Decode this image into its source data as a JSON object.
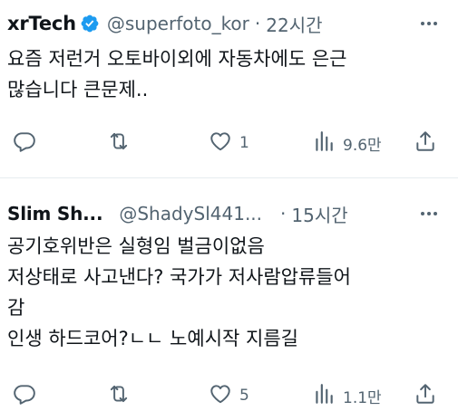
{
  "tweets": [
    {
      "name": "xrTech",
      "verified": true,
      "handle": "@superfoto_kor",
      "separator": "·",
      "time": "22시간",
      "lines": [
        "요즘 저런거 오토바이외에 자동차에도 은근",
        "많습니다 큰문제.."
      ],
      "reply_count": "",
      "retweet_count": "",
      "like_count": "1",
      "view_count": "9.6만"
    },
    {
      "name": "Slim Sh...",
      "verified": false,
      "handle": "@ShadySl441...",
      "separator": "·",
      "time": "15시간",
      "lines": [
        "공기호위반은 실형임  벌금이없음",
        "저상태로 사고낸다? 국가가 저사람압류들어",
        "감",
        "인생 하드코어?ㄴㄴ 노예시작 지름길"
      ],
      "reply_count": "",
      "retweet_count": "",
      "like_count": "5",
      "view_count": "1.1만"
    }
  ],
  "colors": {
    "text": "#0f1419",
    "secondary": "#536471",
    "verified": "#1d9bf0",
    "divider": "#e6ecf0"
  },
  "icons": {
    "reply": "reply-icon",
    "retweet": "retweet-icon",
    "like": "heart-icon",
    "views": "views-chart-icon",
    "share": "share-icon",
    "more": "more-options-icon",
    "verified": "verified-badge-icon"
  }
}
